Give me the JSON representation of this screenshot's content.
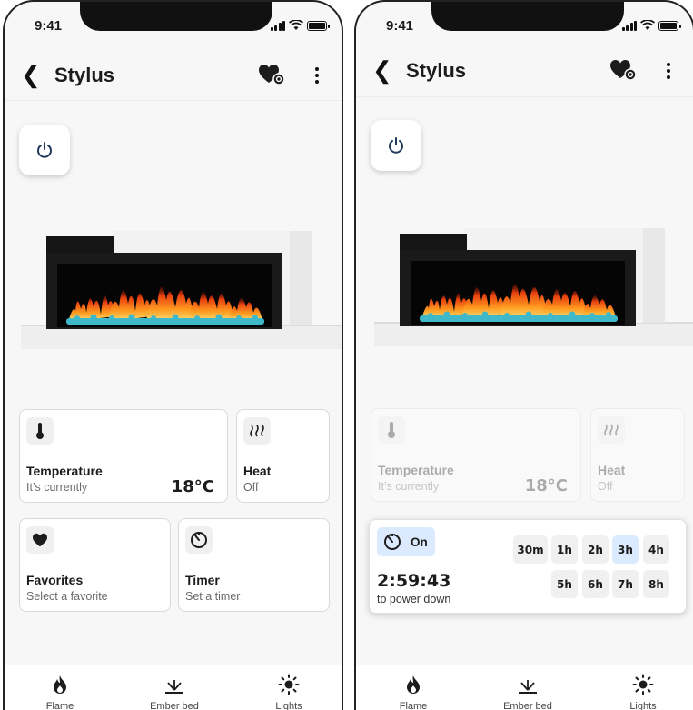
{
  "status": {
    "time": "9:41"
  },
  "header": {
    "title": "Stylus"
  },
  "cards": {
    "temperature": {
      "title": "Temperature",
      "subtitle": "It’s currently",
      "value": "18°C"
    },
    "heat": {
      "title": "Heat",
      "subtitle": "Off"
    },
    "favorites": {
      "title": "Favorites",
      "subtitle": "Select a favorite"
    },
    "timer": {
      "title": "Timer",
      "subtitle": "Set a timer"
    }
  },
  "timer_panel": {
    "state": "On",
    "countdown": "2:59:43",
    "countdown_label": "to power down",
    "options": [
      "30m",
      "1h",
      "2h",
      "3h",
      "4h",
      "5h",
      "6h",
      "7h",
      "8h"
    ],
    "selected": "3h"
  },
  "nav": [
    {
      "label": "Flame",
      "icon": "flame-icon"
    },
    {
      "label": "Ember bed",
      "icon": "ember-bed-icon"
    },
    {
      "label": "Lights",
      "icon": "sun-icon"
    }
  ],
  "colors": {
    "accent_selected": "#dbeaff",
    "card_border": "#d9d9d9",
    "ember": "#3fb8c9",
    "flame": "#ff7a1a"
  }
}
